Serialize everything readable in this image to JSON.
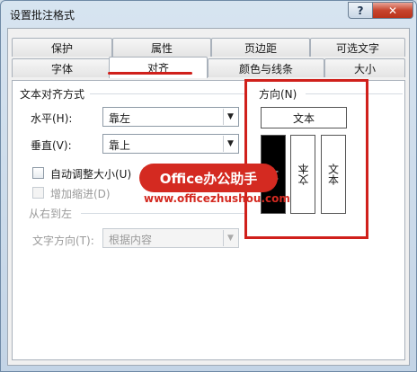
{
  "window": {
    "title": "设置批注格式",
    "help_label": "?",
    "close_label": "✕"
  },
  "tabs_back": [
    "保护",
    "属性",
    "页边距",
    "可选文字"
  ],
  "tabs_front": [
    "字体",
    "对齐",
    "颜色与线条",
    "大小"
  ],
  "active_tab": "对齐",
  "text_alignment": {
    "group_title": "文本对齐方式",
    "horizontal_label": "水平(H):",
    "horizontal_value": "靠左",
    "vertical_label": "垂直(V):",
    "vertical_value": "靠上"
  },
  "options": {
    "auto_size_label": "自动调整大小(U)",
    "auto_size_checked": false,
    "add_indent_label": "增加缩进(D)",
    "add_indent_checked": false
  },
  "rtl": {
    "group_title": "从右到左",
    "direction_label": "文字方向(T):",
    "direction_value": "根据内容"
  },
  "orientation": {
    "group_title": "方向(N)",
    "horizontal_text": "文本",
    "vertical_stacked_text": "文",
    "rotated_up_text": "文本",
    "rotated_down_text": "文本"
  },
  "watermark": {
    "badge_text": "Office办公助手",
    "url": "www.officezhushou.com"
  },
  "highlight_color": "#d0201b"
}
